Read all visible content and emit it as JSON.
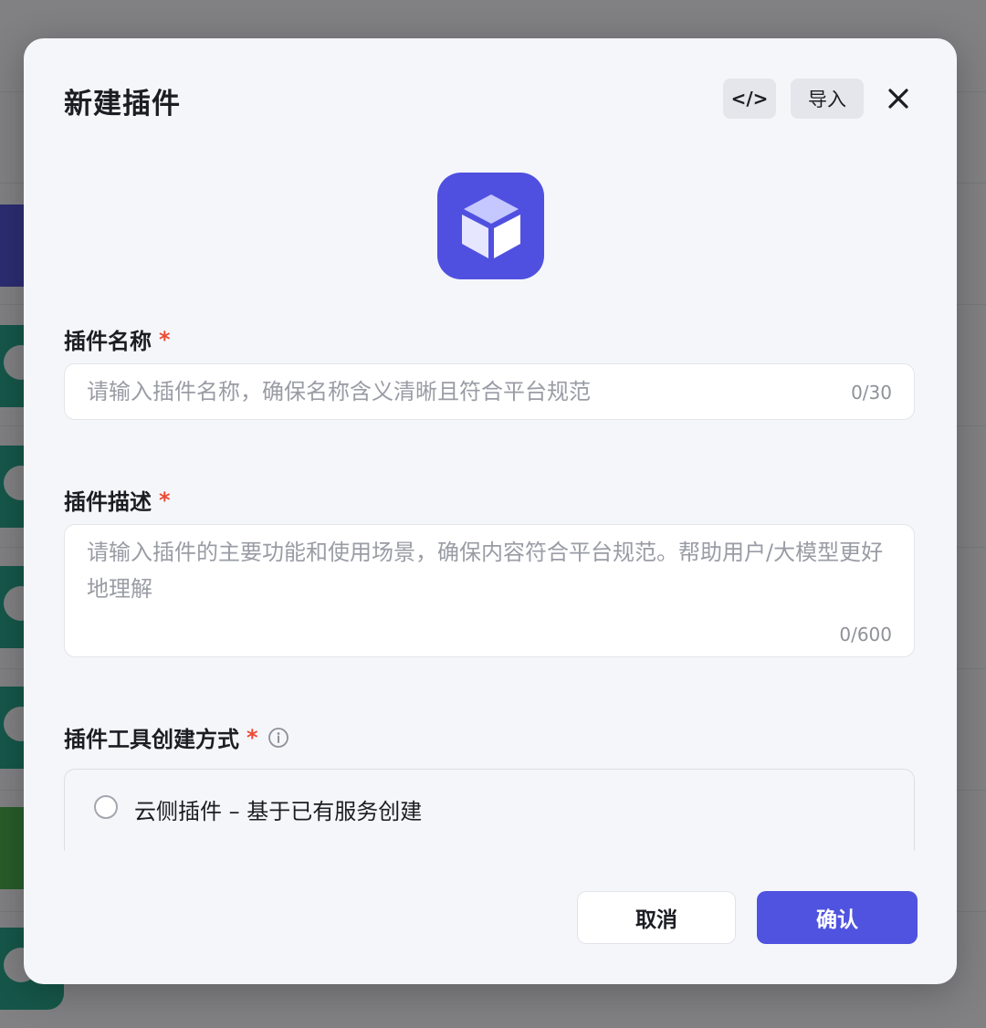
{
  "modal": {
    "title": "新建插件",
    "code_button_label": "</>",
    "import_label": "导入"
  },
  "colors": {
    "accent": "#4f53df",
    "icon_bg": "#5050e0",
    "required": "#ee4a34"
  },
  "name_field": {
    "label": "插件名称",
    "required_mark": "*",
    "placeholder": "请输入插件名称，确保名称含义清晰且符合平台规范",
    "counter": "0/30"
  },
  "desc_field": {
    "label": "插件描述",
    "required_mark": "*",
    "placeholder": "请输入插件的主要功能和使用场景，确保内容符合平台规范。帮助用户/大模型更好地理解",
    "counter": "0/600"
  },
  "creation_method": {
    "label": "插件工具创建方式",
    "required_mark": "*",
    "options": [
      {
        "label": "云侧插件 – 基于已有服务创建",
        "selected": false
      }
    ]
  },
  "footer": {
    "cancel_label": "取消",
    "confirm_label": "确认"
  }
}
